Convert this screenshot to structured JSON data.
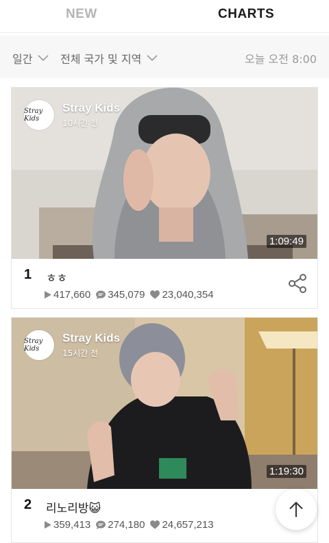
{
  "tabs": [
    {
      "label": "NEW"
    },
    {
      "label": "CHARTS"
    }
  ],
  "filters": {
    "period": "일간",
    "region": "전체 국가 및 지역",
    "updated": "오늘 오전 8:00"
  },
  "videos": [
    {
      "channel": "Stray Kids",
      "posted": "10시간 전",
      "duration": "1:09:49",
      "rank": "1",
      "title": "ㅎㅎ",
      "plays": "417,660",
      "comments": "345,079",
      "likes": "23,040,354"
    },
    {
      "channel": "Stray Kids",
      "posted": "15시간 전",
      "duration": "1:19:30",
      "rank": "2",
      "title": "리노리방😺",
      "plays": "359,413",
      "comments": "274,180",
      "likes": "24,657,213"
    }
  ],
  "avatar_text": "Stray Kids",
  "colors": {
    "tab_active": "#1b1b1b",
    "tab_inactive": "#b4b4b4",
    "filter_bg": "#f7f7f7",
    "icon": "#8a8a8a"
  }
}
